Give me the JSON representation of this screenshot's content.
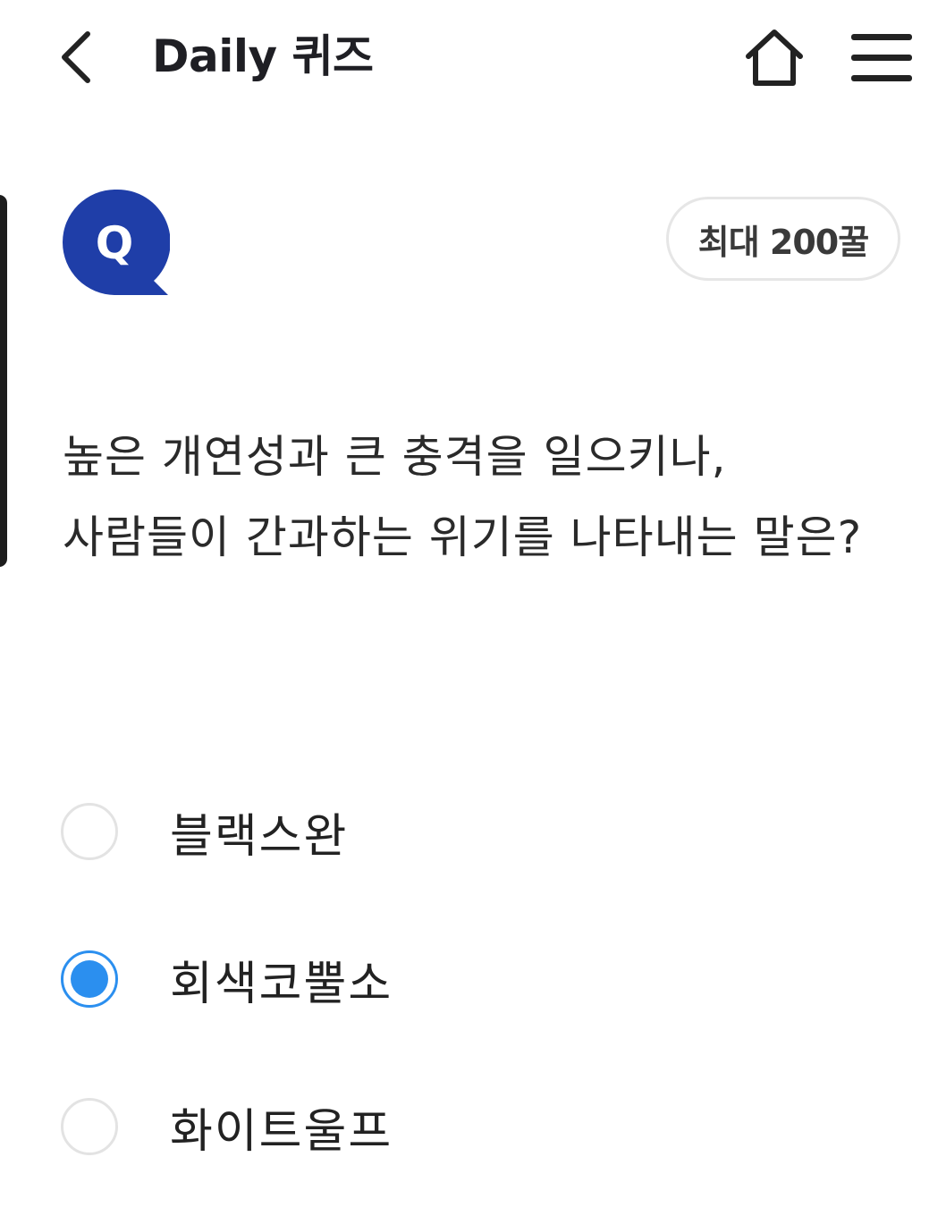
{
  "header": {
    "title": "Daily 퀴즈",
    "back_icon": "chevron-left-icon",
    "home_icon": "home-icon",
    "menu_icon": "hamburger-menu-icon"
  },
  "quiz": {
    "badge_letter": "Q",
    "badge_color": "#1f3ea8",
    "reward_label": "최대 200꿀",
    "question": "높은 개연성과 큰 충격을 일으키나, 사람들이 간과하는 위기를 나타내는 말은?",
    "selected_index": 1,
    "accent_color": "#2b8fef",
    "options": [
      {
        "label": "블랙스완",
        "selected": false
      },
      {
        "label": "회색코뿔소",
        "selected": true
      },
      {
        "label": "화이트울프",
        "selected": false
      }
    ]
  }
}
